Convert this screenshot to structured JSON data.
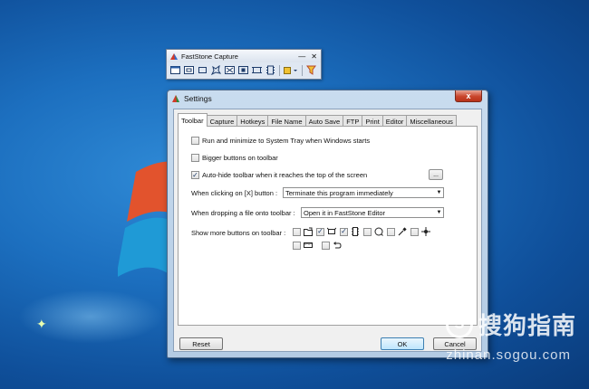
{
  "capture_toolbar": {
    "title": "FastStone Capture",
    "minimize_label": "—",
    "close_label": "✕",
    "tools": [
      "capture-active-window-icon",
      "capture-window-object-icon",
      "capture-rectangle-icon",
      "capture-freehand-icon",
      "capture-fullscreen-icon",
      "capture-fixed-region-icon",
      "capture-scrolling-icon",
      "video-recorder-icon",
      "output-dropdown-icon",
      "settings-menu-icon"
    ]
  },
  "dialog": {
    "title": "Settings",
    "close_label": "x",
    "tabs": [
      "Toolbar",
      "Capture",
      "Hotkeys",
      "File Name",
      "Auto Save",
      "FTP",
      "Print",
      "Editor",
      "Miscellaneous"
    ],
    "active_tab": "Toolbar",
    "options": {
      "run_minimize": {
        "label": "Run and minimize to System Tray when Windows starts",
        "checked": false
      },
      "bigger_buttons": {
        "label": "Bigger buttons on toolbar",
        "checked": false
      },
      "auto_hide": {
        "label": "Auto-hide toolbar when it reaches the top of the screen",
        "checked": true
      }
    },
    "dots_label": "...",
    "close_action": {
      "label": "When clicking on [X] button :",
      "value": "Terminate this program immediately"
    },
    "drop_action": {
      "label": "When dropping a file onto toolbar :",
      "value": "Open it in FastStone Editor"
    },
    "more_buttons": {
      "label": "Show more buttons on toolbar :"
    },
    "buttons": {
      "reset": "Reset",
      "ok": "OK",
      "cancel": "Cancel"
    }
  },
  "watermark": {
    "mark": "S",
    "text": "搜狗指南",
    "url": "zhinan.sogou.com"
  },
  "colors": {
    "desktop": "#1c6fbf",
    "dialog_frame": "#b3cbe4",
    "close_red": "#c9452c"
  }
}
